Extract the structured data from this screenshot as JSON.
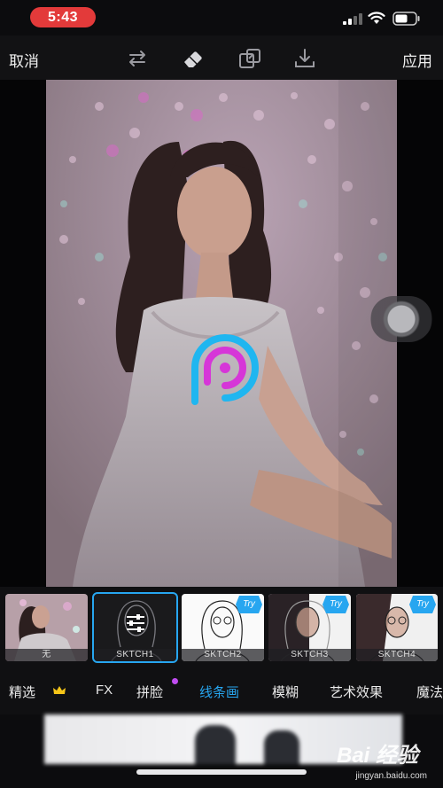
{
  "status": {
    "time": "5:43"
  },
  "toolbar": {
    "cancel_label": "取消",
    "apply_label": "应用",
    "icons": [
      "swap-icon",
      "eraser-icon",
      "compare-icon",
      "download-icon"
    ]
  },
  "canvas": {
    "logo": "picsart-logo"
  },
  "filters": [
    {
      "label": "无",
      "badge": ""
    },
    {
      "label": "SKTCH1",
      "badge": "",
      "selected": true
    },
    {
      "label": "SKTCH2",
      "badge": "Try"
    },
    {
      "label": "SKTCH3",
      "badge": "Try"
    },
    {
      "label": "SKTCH4",
      "badge": "Try"
    }
  ],
  "tabs": [
    {
      "label": "精选",
      "icon": "crown-icon"
    },
    {
      "label": "FX"
    },
    {
      "label": "拼脸",
      "dot": true
    },
    {
      "label": "线条画",
      "active": true
    },
    {
      "label": "模糊"
    },
    {
      "label": "艺术效果"
    },
    {
      "label": "魔法"
    }
  ],
  "watermark": {
    "main": "Bai 经验",
    "sub": "jingyan.baidu.com"
  },
  "colors": {
    "accent": "#27a6f0",
    "status_pill": "#e33a3a",
    "tab_dot": "#c04cf0"
  }
}
